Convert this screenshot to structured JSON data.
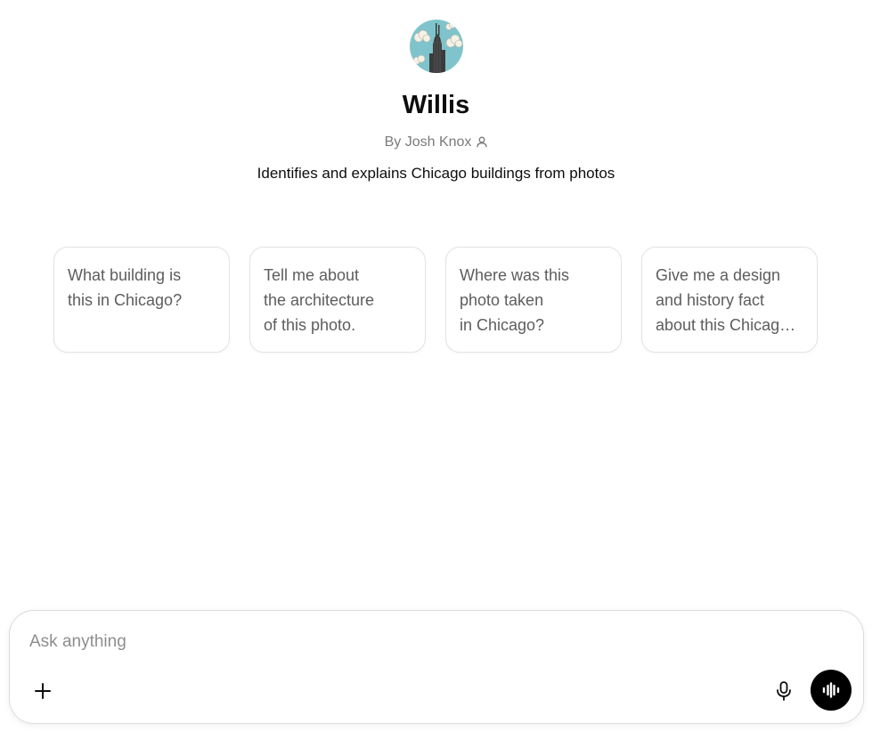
{
  "gpt": {
    "avatar_icon": "skyscraper-avatar-icon",
    "name": "Willis",
    "author": "By Josh Knox",
    "author_icon": "person-icon",
    "description": "Identifies and explains Chicago buildings from photos"
  },
  "starters": [
    {
      "text": "What building is\nthis in Chicago?"
    },
    {
      "text": "Tell me about\nthe architecture\nof this photo."
    },
    {
      "text": "Where was this\nphoto taken\nin Chicago?"
    },
    {
      "text": "Give me a design and history fact about this Chicago building."
    }
  ],
  "composer": {
    "placeholder": "Ask anything",
    "value": "",
    "attach_icon": "plus-icon",
    "mic_icon": "microphone-icon",
    "voice_icon": "voice-waveform-icon"
  },
  "colors": {
    "avatar_sky": "#7fc4cc",
    "voice_button_bg": "#000000",
    "secondary_text": "#7a7a7a",
    "card_border": "#e3e3e3"
  }
}
